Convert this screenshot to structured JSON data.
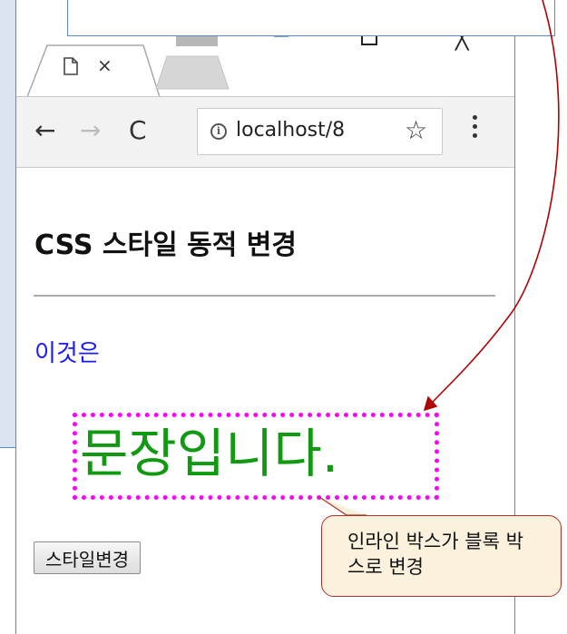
{
  "browser": {
    "tab": {
      "close_glyph": "×"
    },
    "toolbar": {
      "back_glyph": "←",
      "forward_glyph": "→",
      "reload_glyph": "C",
      "url": "localhost/8",
      "info_glyph": "i",
      "star_glyph": "☆"
    },
    "window_controls": {
      "close_glyph": "╳"
    }
  },
  "page": {
    "heading": "CSS 스타일 동적 변경",
    "inline_text": "이것은",
    "block_text": "문장입니다.",
    "button_label": "스타일변경"
  },
  "callout": {
    "text": "인라인 박스가 블록 박스로 변경"
  },
  "colors": {
    "blue_text": "#1a1aff",
    "green_text": "#119911",
    "dotted_border": "#ff00ff",
    "arrow": "#b00000",
    "callout_bg": "#fbf1dc"
  }
}
